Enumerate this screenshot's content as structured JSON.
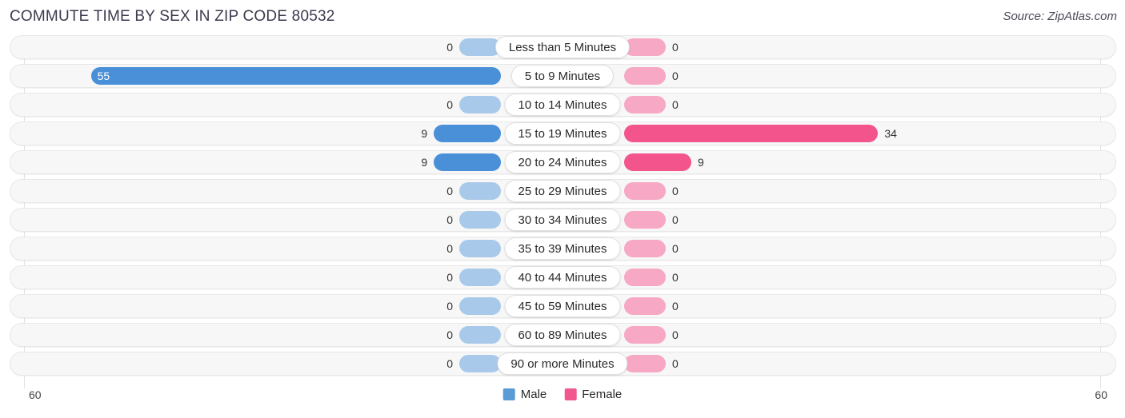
{
  "header": {
    "title": "COMMUTE TIME BY SEX IN ZIP CODE 80532",
    "source": "Source: ZipAtlas.com"
  },
  "footer": {
    "axis_left": "60",
    "axis_right": "60",
    "legend": [
      {
        "label": "Male",
        "color": "#5b9bd5"
      },
      {
        "label": "Female",
        "color": "#f2568f"
      }
    ]
  },
  "chart_data": {
    "type": "bar",
    "subtype": "diverging-bar",
    "title": "COMMUTE TIME BY SEX IN ZIP CODE 80532",
    "xlabel": "",
    "ylabel": "",
    "xlim": [
      60,
      60
    ],
    "axis_max_left": 60,
    "axis_max_right": 60,
    "grid": true,
    "legend_position": "bottom-center",
    "categories": [
      "Less than 5 Minutes",
      "5 to 9 Minutes",
      "10 to 14 Minutes",
      "15 to 19 Minutes",
      "20 to 24 Minutes",
      "25 to 29 Minutes",
      "30 to 34 Minutes",
      "35 to 39 Minutes",
      "40 to 44 Minutes",
      "45 to 59 Minutes",
      "60 to 89 Minutes",
      "90 or more Minutes"
    ],
    "series": [
      {
        "name": "Male",
        "color": "#4a90d9",
        "values": [
          0,
          55,
          0,
          9,
          9,
          0,
          0,
          0,
          0,
          0,
          0,
          0
        ]
      },
      {
        "name": "Female",
        "color": "#f4548c",
        "values": [
          0,
          0,
          0,
          34,
          9,
          0,
          0,
          0,
          0,
          0,
          0,
          0
        ]
      }
    ]
  },
  "rows": [
    {
      "label": "Less than 5 Minutes",
      "male": "0",
      "female": "0"
    },
    {
      "label": "5 to 9 Minutes",
      "male": "55",
      "female": "0"
    },
    {
      "label": "10 to 14 Minutes",
      "male": "0",
      "female": "0"
    },
    {
      "label": "15 to 19 Minutes",
      "male": "9",
      "female": "34"
    },
    {
      "label": "20 to 24 Minutes",
      "male": "9",
      "female": "9"
    },
    {
      "label": "25 to 29 Minutes",
      "male": "0",
      "female": "0"
    },
    {
      "label": "30 to 34 Minutes",
      "male": "0",
      "female": "0"
    },
    {
      "label": "35 to 39 Minutes",
      "male": "0",
      "female": "0"
    },
    {
      "label": "40 to 44 Minutes",
      "male": "0",
      "female": "0"
    },
    {
      "label": "45 to 59 Minutes",
      "male": "0",
      "female": "0"
    },
    {
      "label": "60 to 89 Minutes",
      "male": "0",
      "female": "0"
    },
    {
      "label": "90 or more Minutes",
      "male": "0",
      "female": "0"
    }
  ]
}
